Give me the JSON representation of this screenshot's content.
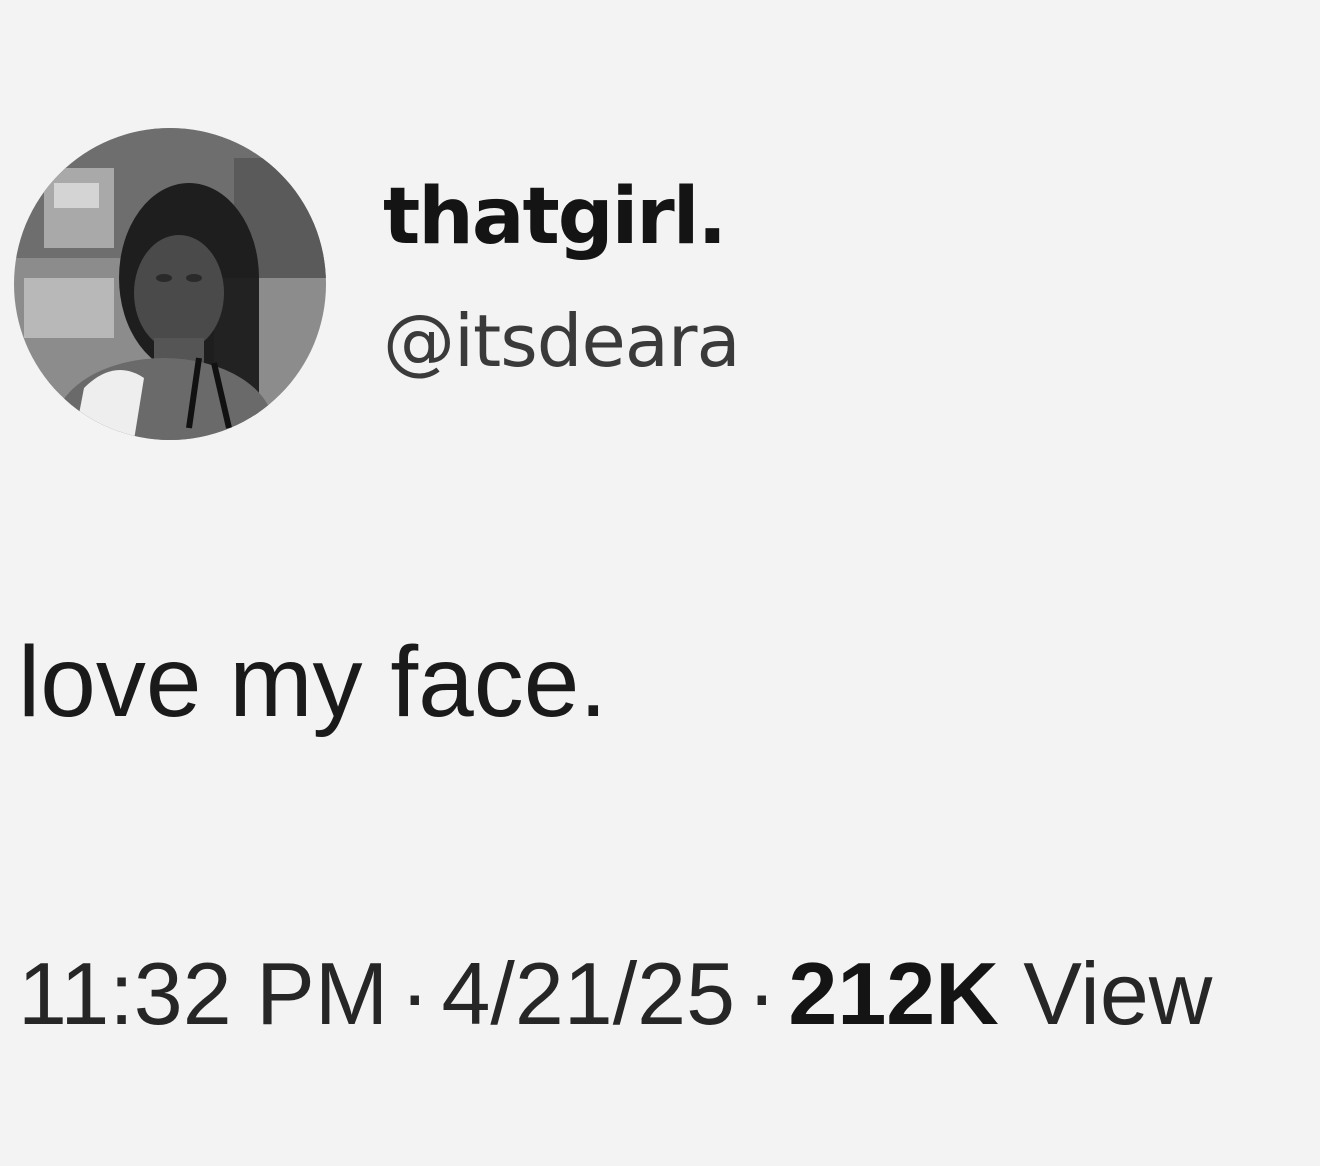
{
  "author": {
    "display_name": "thatgirl.",
    "handle": "@itsdeara",
    "avatar_icon": "profile-photo"
  },
  "tweet": {
    "text": "love my face."
  },
  "meta": {
    "time": "11:32 PM",
    "separator": "·",
    "date": "4/21/25",
    "views_count": "212K",
    "views_label": "View"
  },
  "colors": {
    "background": "#f3f3f3",
    "text": "#111111",
    "secondary_text": "#3a3a3a"
  }
}
